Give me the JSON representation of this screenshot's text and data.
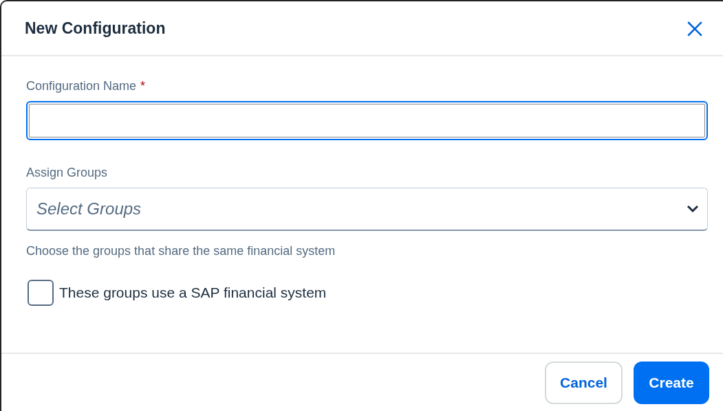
{
  "dialog": {
    "title": "New Configuration"
  },
  "name_field": {
    "label": "Configuration Name",
    "required_mark": "*",
    "focused": true
  },
  "groups_field": {
    "label": "Assign Groups",
    "placeholder": "Select Groups",
    "hint": "Choose the groups that share the same financial system"
  },
  "sap_checkbox": {
    "label": "These groups use a SAP financial system",
    "checked": false
  },
  "buttons": [
    {
      "label": "Cancel",
      "kind": "secondary"
    },
    {
      "label": "Create",
      "kind": "primary"
    }
  ]
}
